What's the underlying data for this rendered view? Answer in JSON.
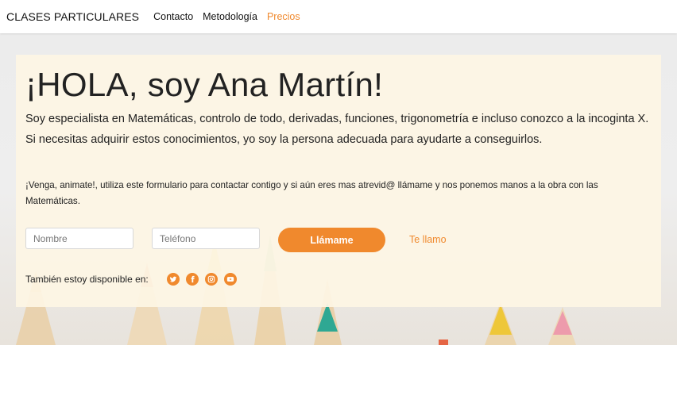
{
  "nav": {
    "brand": "CLASES PARTICULARES",
    "links": [
      {
        "label": "Contacto"
      },
      {
        "label": "Metodología"
      },
      {
        "label": "Precios"
      }
    ]
  },
  "hero": {
    "title": "¡HOLA, soy Ana Martín!",
    "lead": "Soy especialista en Matemáticas, controlo de todo, derivadas, funciones, trigonometría e incluso conozco a la incoginta X. Si necesitas adquirir estos conocimientos, yo soy la persona adecuada para ayudarte a conseguirlos.",
    "sub": "¡Venga, animate!, utiliza este formulario para contactar contigo y si aún eres mas atrevid@ llámame y nos ponemos manos a la obra con las Matemáticas.",
    "form": {
      "name_placeholder": "Nombre",
      "phone_placeholder": "Teléfono",
      "call_button": "Llámame",
      "call_link": "Te llamo"
    },
    "social_label": "También estoy disponible en:",
    "social_icons": [
      "twitter-icon",
      "facebook-icon",
      "instagram-icon",
      "youtube-icon"
    ]
  },
  "colors": {
    "accent": "#f0892d",
    "card": "#fdf5e4"
  }
}
